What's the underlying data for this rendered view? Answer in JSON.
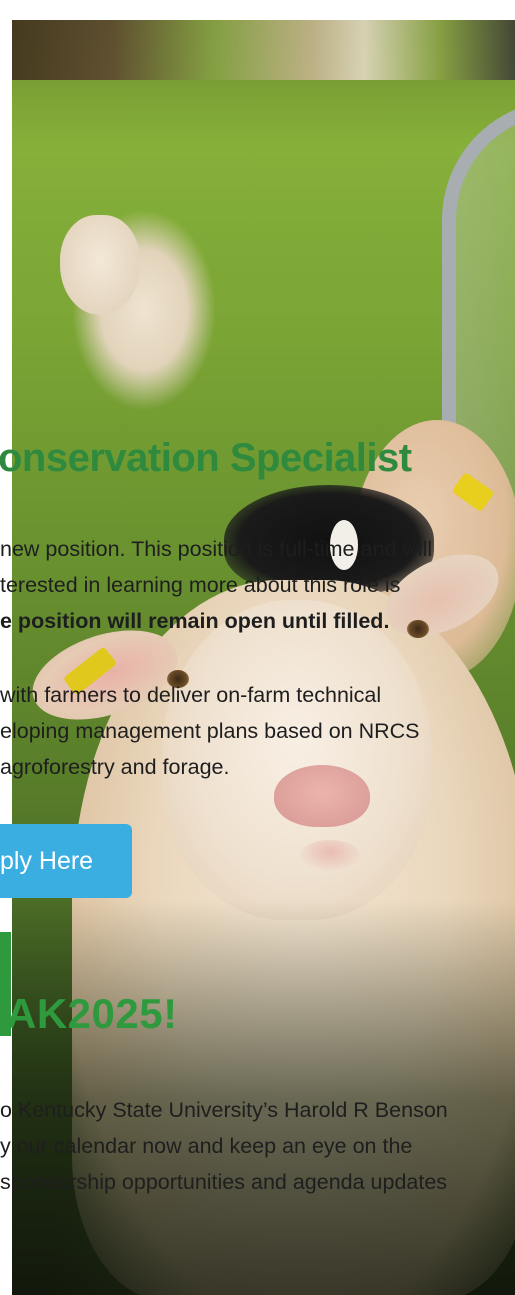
{
  "job": {
    "title": "onservation Specialist",
    "description_lines": [
      "new position. This position is full-time and will",
      "terested in learning more about this role is"
    ],
    "open_notice": "e position will remain open until filled.",
    "duties_lines": [
      " with farmers to deliver on-farm technical",
      "eloping management plans based on NRCS",
      "agroforestry and forage."
    ],
    "apply_label": "ply Here"
  },
  "event": {
    "title": "AK2025!",
    "lines": [
      "o Kentucky State University’s Harold R Benson",
      "y our calendar now and keep an eye on the",
      "sponsorship opportunities and agenda updates"
    ]
  },
  "colors": {
    "heading_green": "#2f8a3e",
    "accent_green": "#2f9a3d",
    "button_blue": "#3aaee0"
  }
}
